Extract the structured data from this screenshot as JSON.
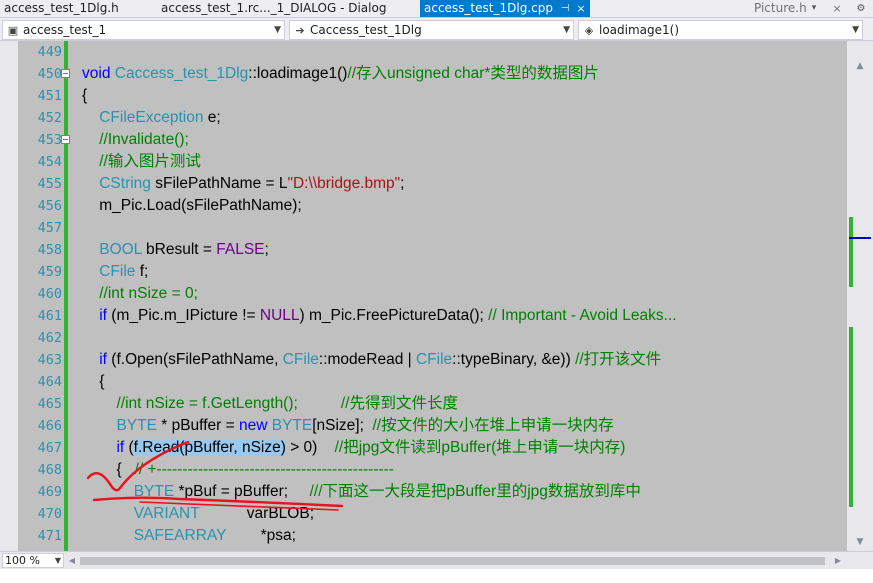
{
  "tabs": [
    {
      "label": "access_test_1Dlg.h",
      "active": false
    },
    {
      "label": "access_test_1.rc..._1_DIALOG - Dialog",
      "active": false
    },
    {
      "label": "access_test_1Dlg.cpp",
      "active": true,
      "pin": "⊣",
      "close": "×"
    },
    {
      "label": "Picture.h",
      "active": false,
      "close": "×"
    }
  ],
  "tab_dropdown_icon": "▾",
  "tab_more_icon": "⚙",
  "nav": {
    "project": "access_test_1",
    "class": "Caccess_test_1Dlg",
    "member": "loadimage1()"
  },
  "split_icon": "⇟",
  "zoom": "100 %",
  "colors": {
    "keyword": "#0000ff",
    "type": "#2b91af",
    "comment": "#008000",
    "string": "#a31515",
    "macro": "#6f008a",
    "change_bar": "#32b432",
    "editor_background": "#c0c0c0",
    "active_tab": "#007acc",
    "annotation": "#e8121c"
  },
  "code": {
    "lines": [
      {
        "n": "449",
        "segs": []
      },
      {
        "n": "450",
        "collapse": "−",
        "segs": [
          {
            "c": "kw",
            "t": "void "
          },
          {
            "c": "ty",
            "t": "Caccess_test_1Dlg"
          },
          {
            "c": "",
            "t": "::"
          },
          {
            "c": "",
            "t": "loadimage1()"
          },
          {
            "c": "cm",
            "t": "//存入unsigned char*类型的数据图片"
          }
        ]
      },
      {
        "n": "451",
        "segs": [
          {
            "c": "",
            "t": "{"
          }
        ]
      },
      {
        "n": "452",
        "segs": [
          {
            "c": "",
            "t": "    "
          },
          {
            "c": "ty",
            "t": "CFileException"
          },
          {
            "c": "",
            "t": " e;"
          }
        ]
      },
      {
        "n": "453",
        "collapse": "−",
        "segs": [
          {
            "c": "",
            "t": "    "
          },
          {
            "c": "cm",
            "t": "//Invalidate();"
          }
        ]
      },
      {
        "n": "454",
        "segs": [
          {
            "c": "",
            "t": "    "
          },
          {
            "c": "cm",
            "t": "//输入图片测试"
          }
        ]
      },
      {
        "n": "455",
        "segs": [
          {
            "c": "",
            "t": "    "
          },
          {
            "c": "ty",
            "t": "CString"
          },
          {
            "c": "",
            "t": " sFilePathName = L"
          },
          {
            "c": "st",
            "t": "\"D:\\\\bridge.bmp\""
          },
          {
            "c": "",
            "t": ";"
          }
        ]
      },
      {
        "n": "456",
        "segs": [
          {
            "c": "",
            "t": "    m_Pic.Load(sFilePathName);"
          }
        ]
      },
      {
        "n": "457",
        "segs": []
      },
      {
        "n": "458",
        "segs": [
          {
            "c": "",
            "t": "    "
          },
          {
            "c": "ty",
            "t": "BOOL"
          },
          {
            "c": "",
            "t": " bResult = "
          },
          {
            "c": "mc",
            "t": "FALSE"
          },
          {
            "c": "",
            "t": ";"
          }
        ]
      },
      {
        "n": "459",
        "segs": [
          {
            "c": "",
            "t": "    "
          },
          {
            "c": "ty",
            "t": "CFile"
          },
          {
            "c": "",
            "t": " f;"
          }
        ]
      },
      {
        "n": "460",
        "segs": [
          {
            "c": "",
            "t": "    "
          },
          {
            "c": "cm",
            "t": "//int nSize = 0;"
          }
        ]
      },
      {
        "n": "461",
        "segs": [
          {
            "c": "",
            "t": "    "
          },
          {
            "c": "kw",
            "t": "if"
          },
          {
            "c": "",
            "t": " (m_Pic.m_IPicture != "
          },
          {
            "c": "mc",
            "t": "NULL"
          },
          {
            "c": "",
            "t": ") m_Pic.FreePictureData(); "
          },
          {
            "c": "cm",
            "t": "// Important - Avoid Leaks..."
          }
        ]
      },
      {
        "n": "462",
        "segs": []
      },
      {
        "n": "463",
        "segs": [
          {
            "c": "",
            "t": "    "
          },
          {
            "c": "kw",
            "t": "if"
          },
          {
            "c": "",
            "t": " (f.Open(sFilePathName, "
          },
          {
            "c": "ty",
            "t": "CFile"
          },
          {
            "c": "",
            "t": "::"
          },
          {
            "c": "",
            "t": "modeRead | "
          },
          {
            "c": "ty",
            "t": "CFile"
          },
          {
            "c": "",
            "t": "::typeBinary, &e)) "
          },
          {
            "c": "cm",
            "t": "//打开该文件"
          }
        ]
      },
      {
        "n": "464",
        "segs": [
          {
            "c": "",
            "t": "    {"
          }
        ]
      },
      {
        "n": "465",
        "segs": [
          {
            "c": "",
            "t": "        "
          },
          {
            "c": "cm",
            "t": "//int nSize = f.GetLength();          //先得到文件长度"
          }
        ]
      },
      {
        "n": "466",
        "segs": [
          {
            "c": "",
            "t": "        "
          },
          {
            "c": "ty",
            "t": "BYTE"
          },
          {
            "c": "",
            "t": " * pBuffer = "
          },
          {
            "c": "kw",
            "t": "new "
          },
          {
            "c": "ty",
            "t": "BYTE"
          },
          {
            "c": "",
            "t": "[nSize];  "
          },
          {
            "c": "cm",
            "t": "//按文件的大小在堆上申请一块内存"
          }
        ]
      },
      {
        "n": "467",
        "segs": [
          {
            "c": "",
            "t": "        "
          },
          {
            "c": "kw",
            "t": "if"
          },
          {
            "c": "",
            "t": " ("
          },
          {
            "c": "sel",
            "t": "f.Read(pBuffer, nSize)"
          },
          {
            "c": "",
            "t": " > 0)    "
          },
          {
            "c": "cm",
            "t": "//把jpg文件读到pBuffer(堆上申请一块内存)"
          }
        ]
      },
      {
        "n": "468",
        "segs": [
          {
            "c": "",
            "t": "        {   "
          },
          {
            "c": "cm",
            "t": "// +----------------------------------------------"
          }
        ]
      },
      {
        "n": "469",
        "segs": [
          {
            "c": "",
            "t": "            "
          },
          {
            "c": "ty",
            "t": "BYTE"
          },
          {
            "c": "",
            "t": " *pBuf = pBuffer;     "
          },
          {
            "c": "cm",
            "t": "///下面这一大段是把pBuffer里的jpg数据放到库中"
          }
        ]
      },
      {
        "n": "470",
        "segs": [
          {
            "c": "",
            "t": "            "
          },
          {
            "c": "ty",
            "t": "VARIANT"
          },
          {
            "c": "",
            "t": "           varBLOB;"
          }
        ]
      },
      {
        "n": "471",
        "segs": [
          {
            "c": "",
            "t": "            "
          },
          {
            "c": "ty",
            "t": "SAFEARRAY"
          },
          {
            "c": "",
            "t": "        *psa;"
          }
        ]
      }
    ]
  },
  "scroll": {
    "up": "▲",
    "down": "▼",
    "left": "◀",
    "right": "▶"
  }
}
